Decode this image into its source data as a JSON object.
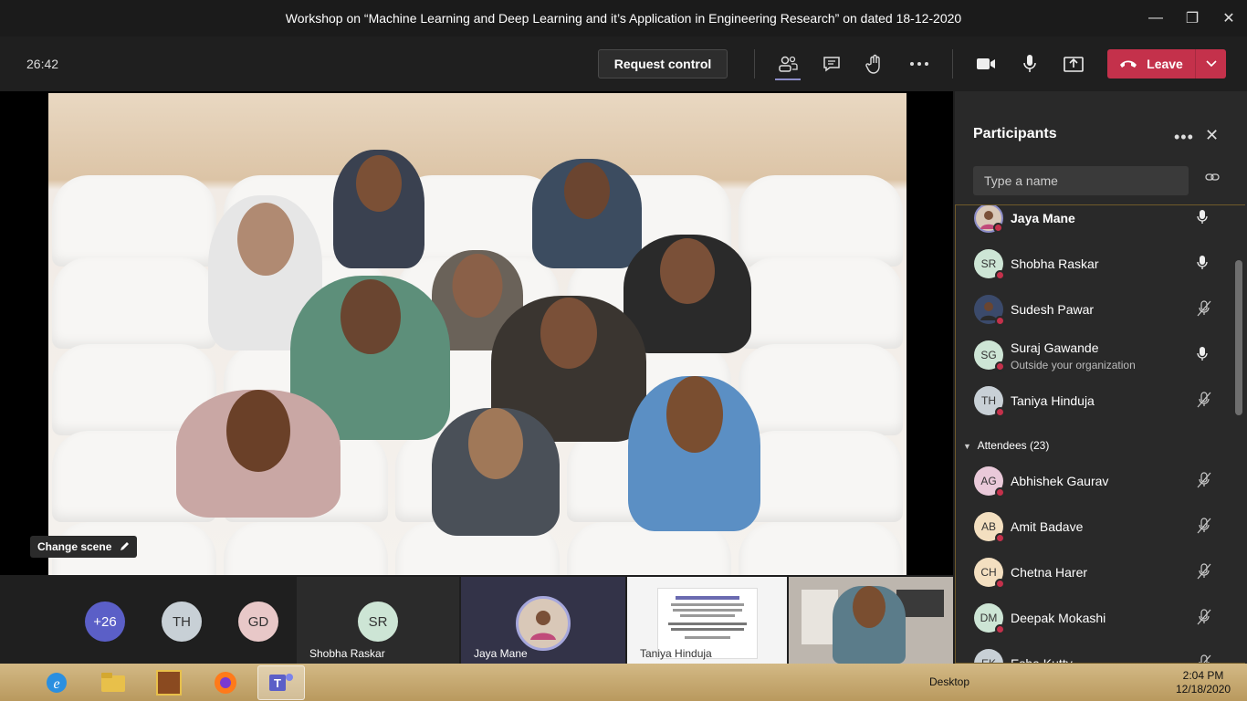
{
  "window": {
    "title": "Workshop on “Machine Learning and Deep Learning and it’s Application in Engineering Research” on dated 18-12-2020",
    "minimize": "—",
    "maximize": "❐",
    "close": "✕"
  },
  "toolbar": {
    "timer": "26:42",
    "request_control": "Request control",
    "leave_label": "Leave",
    "icons": [
      "participants-icon",
      "chat-icon",
      "raise-hand-icon",
      "more-icon",
      "camera-icon",
      "microphone-icon",
      "share-icon",
      "hangup-icon",
      "chevron-down-icon"
    ],
    "leave_color": "#c4314b"
  },
  "stage": {
    "change_scene": "Change scene"
  },
  "gallery": {
    "overflow": "+26",
    "avatars": [
      {
        "initials": "TH",
        "color": "#c8d0d6"
      },
      {
        "initials": "GD",
        "color": "#e8c8c8"
      }
    ],
    "tiles": [
      {
        "initials": "SR",
        "name": "Shobha Raskar",
        "color": "#cde5d5"
      },
      {
        "name": "Jaya Mane"
      },
      {
        "name": "Taniya Hinduja"
      }
    ]
  },
  "panel": {
    "title": "Participants",
    "more": "•••",
    "close": "✕",
    "search_placeholder": "Type a name",
    "presenters": [
      {
        "name": "Jaya Mane",
        "initials": "",
        "avatar_color": "#d9c8b8",
        "mic": "on",
        "bold": true
      },
      {
        "name": "Shobha Raskar",
        "initials": "SR",
        "avatar_color": "#cde5d5",
        "mic": "on"
      },
      {
        "name": "Sudesh Pawar",
        "initials": "",
        "avatar_color": "#3b4a6b",
        "mic": "off"
      },
      {
        "name": "Suraj Gawande",
        "sub": "Outside your organization",
        "initials": "SG",
        "avatar_color": "#cde5d5",
        "mic": "on"
      },
      {
        "name": "Taniya Hinduja",
        "initials": "TH",
        "avatar_color": "#c8d0d6",
        "mic": "off"
      }
    ],
    "attendees_label": "Attendees (23)",
    "attendees": [
      {
        "name": "Abhishek Gaurav",
        "initials": "AG",
        "avatar_color": "#e9c9d9",
        "mic": "off"
      },
      {
        "name": "Amit Badave",
        "initials": "AB",
        "avatar_color": "#f3dfc0",
        "mic": "off"
      },
      {
        "name": "Chetna Harer",
        "initials": "CH",
        "avatar_color": "#f3dfc0",
        "mic": "off"
      },
      {
        "name": "Deepak Mokashi",
        "initials": "DM",
        "avatar_color": "#cde5d5",
        "mic": "off"
      },
      {
        "name": "Esha Kutty",
        "initials": "EK",
        "avatar_color": "#c8d0d6",
        "mic": "off"
      }
    ]
  },
  "taskbar": {
    "desktop_label": "Desktop",
    "time": "2:04 PM",
    "date": "12/18/2020",
    "apps": [
      "internet-explorer-icon",
      "file-explorer-icon",
      "box-game-icon",
      "firefox-icon",
      "teams-icon"
    ]
  }
}
